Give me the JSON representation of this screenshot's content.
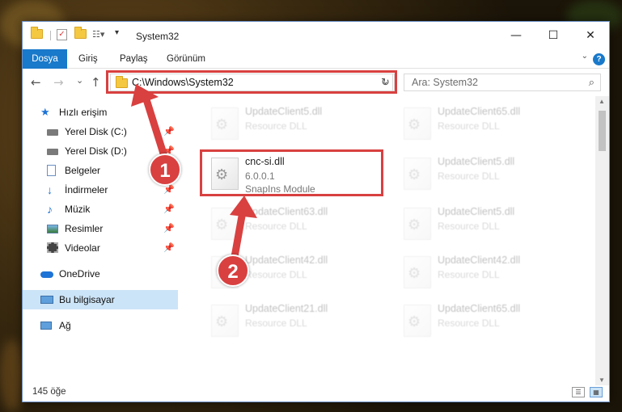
{
  "window": {
    "title": "System32",
    "controls": {
      "minimize": "—",
      "maximize": "☐",
      "close": "✕"
    }
  },
  "ribbon": {
    "tabs": [
      {
        "label": "Dosya",
        "active": true
      },
      {
        "label": "Giriş"
      },
      {
        "label": "Paylaş"
      },
      {
        "label": "Görünüm"
      }
    ],
    "help": "?"
  },
  "nav": {
    "back": "←",
    "forward": "→",
    "recent": "⌄",
    "up": "↑",
    "address": "C:\\Windows\\System32",
    "address_chevron": "⌄",
    "refresh": "↻",
    "search_placeholder": "Ara: System32"
  },
  "sidebar": {
    "items": [
      {
        "label": "Hızlı erişim",
        "icon": "star-icon",
        "pinned": false
      },
      {
        "label": "Yerel Disk (C:)",
        "icon": "drive-icon",
        "pinned": true
      },
      {
        "label": "Yerel Disk (D:)",
        "icon": "drive-icon",
        "pinned": true
      },
      {
        "label": "Belgeler",
        "icon": "documents-icon",
        "pinned": true
      },
      {
        "label": "İndirmeler",
        "icon": "download-icon",
        "pinned": true
      },
      {
        "label": "Müzik",
        "icon": "music-icon",
        "pinned": true
      },
      {
        "label": "Resimler",
        "icon": "pictures-icon",
        "pinned": true
      },
      {
        "label": "Videolar",
        "icon": "videos-icon",
        "pinned": true
      },
      {
        "label": "OneDrive",
        "icon": "cloud-icon"
      },
      {
        "label": "Bu bilgisayar",
        "icon": "computer-icon",
        "selected": true
      },
      {
        "label": "Ağ",
        "icon": "network-icon"
      }
    ]
  },
  "files": [
    {
      "name": "UpdateClient5.dll",
      "line2": "Resource DLL",
      "line3": "",
      "faded": true
    },
    {
      "name": "UpdateClient65.dll",
      "line2": "Resource DLL",
      "line3": "",
      "faded": true
    },
    {
      "name": "cnc-si.dll",
      "line2": "6.0.0.1",
      "line3": "SnapIns Module",
      "faded": false
    },
    {
      "name": "UpdateClient5.dll",
      "line2": "Resource DLL",
      "line3": "",
      "faded": true
    },
    {
      "name": "UpdateClient63.dll",
      "line2": "Resource DLL",
      "line3": "",
      "faded": true
    },
    {
      "name": "UpdateClient5.dll",
      "line2": "Resource DLL",
      "line3": "",
      "faded": true
    },
    {
      "name": "UpdateClient42.dll",
      "line2": "Resource DLL",
      "line3": "",
      "faded": true
    },
    {
      "name": "UpdateClient42.dll",
      "line2": "Resource DLL",
      "line3": "",
      "faded": true
    },
    {
      "name": "UpdateClient21.dll",
      "line2": "Resource DLL",
      "line3": "",
      "faded": true
    },
    {
      "name": "UpdateClient65.dll",
      "line2": "Resource DLL",
      "line3": "",
      "faded": true
    }
  ],
  "status": {
    "count": "145 öğe"
  },
  "annotations": {
    "step1": "1",
    "step2": "2",
    "color": "#d94040"
  }
}
